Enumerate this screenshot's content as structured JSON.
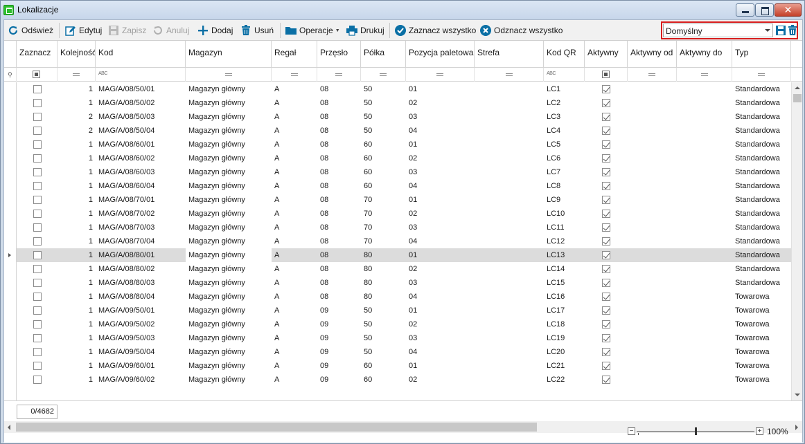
{
  "window": {
    "title": "Lokalizacje"
  },
  "toolbar": {
    "refresh": "Odśwież",
    "edit": "Edytuj",
    "save": "Zapisz",
    "cancel": "Anuluj",
    "add": "Dodaj",
    "delete": "Usuń",
    "operations": "Operacje",
    "print": "Drukuj",
    "select_all": "Zaznacz wszystko",
    "deselect_all": "Odznacz wszystko",
    "layout_value": "Domyślny"
  },
  "columns": [
    "Zaznacz",
    "Kolejność",
    "Kod",
    "Magazyn",
    "Regał",
    "Przęsło",
    "Półka",
    "Pozycja paletowa",
    "Strefa",
    "Kod QR",
    "Aktywny",
    "Aktywny od",
    "Aktywny do",
    "Typ"
  ],
  "rows": [
    {
      "kolejnosc": "1",
      "kod": "MAG/A/08/50/01",
      "magazyn": "Magazyn główny",
      "regal": "A",
      "przeslo": "08",
      "polka": "50",
      "pozycja": "01",
      "strefa": "",
      "kodqr": "LC1",
      "typ": "Standardowa"
    },
    {
      "kolejnosc": "1",
      "kod": "MAG/A/08/50/02",
      "magazyn": "Magazyn główny",
      "regal": "A",
      "przeslo": "08",
      "polka": "50",
      "pozycja": "02",
      "strefa": "",
      "kodqr": "LC2",
      "typ": "Standardowa"
    },
    {
      "kolejnosc": "2",
      "kod": "MAG/A/08/50/03",
      "magazyn": "Magazyn główny",
      "regal": "A",
      "przeslo": "08",
      "polka": "50",
      "pozycja": "03",
      "strefa": "",
      "kodqr": "LC3",
      "typ": "Standardowa"
    },
    {
      "kolejnosc": "2",
      "kod": "MAG/A/08/50/04",
      "magazyn": "Magazyn główny",
      "regal": "A",
      "przeslo": "08",
      "polka": "50",
      "pozycja": "04",
      "strefa": "",
      "kodqr": "LC4",
      "typ": "Standardowa"
    },
    {
      "kolejnosc": "1",
      "kod": "MAG/A/08/60/01",
      "magazyn": "Magazyn główny",
      "regal": "A",
      "przeslo": "08",
      "polka": "60",
      "pozycja": "01",
      "strefa": "",
      "kodqr": "LC5",
      "typ": "Standardowa"
    },
    {
      "kolejnosc": "1",
      "kod": "MAG/A/08/60/02",
      "magazyn": "Magazyn główny",
      "regal": "A",
      "przeslo": "08",
      "polka": "60",
      "pozycja": "02",
      "strefa": "",
      "kodqr": "LC6",
      "typ": "Standardowa"
    },
    {
      "kolejnosc": "1",
      "kod": "MAG/A/08/60/03",
      "magazyn": "Magazyn główny",
      "regal": "A",
      "przeslo": "08",
      "polka": "60",
      "pozycja": "03",
      "strefa": "",
      "kodqr": "LC7",
      "typ": "Standardowa"
    },
    {
      "kolejnosc": "1",
      "kod": "MAG/A/08/60/04",
      "magazyn": "Magazyn główny",
      "regal": "A",
      "przeslo": "08",
      "polka": "60",
      "pozycja": "04",
      "strefa": "",
      "kodqr": "LC8",
      "typ": "Standardowa"
    },
    {
      "kolejnosc": "1",
      "kod": "MAG/A/08/70/01",
      "magazyn": "Magazyn główny",
      "regal": "A",
      "przeslo": "08",
      "polka": "70",
      "pozycja": "01",
      "strefa": "",
      "kodqr": "LC9",
      "typ": "Standardowa"
    },
    {
      "kolejnosc": "1",
      "kod": "MAG/A/08/70/02",
      "magazyn": "Magazyn główny",
      "regal": "A",
      "przeslo": "08",
      "polka": "70",
      "pozycja": "02",
      "strefa": "",
      "kodqr": "LC10",
      "typ": "Standardowa"
    },
    {
      "kolejnosc": "1",
      "kod": "MAG/A/08/70/03",
      "magazyn": "Magazyn główny",
      "regal": "A",
      "przeslo": "08",
      "polka": "70",
      "pozycja": "03",
      "strefa": "",
      "kodqr": "LC11",
      "typ": "Standardowa"
    },
    {
      "kolejnosc": "1",
      "kod": "MAG/A/08/70/04",
      "magazyn": "Magazyn główny",
      "regal": "A",
      "przeslo": "08",
      "polka": "70",
      "pozycja": "04",
      "strefa": "",
      "kodqr": "LC12",
      "typ": "Standardowa"
    },
    {
      "kolejnosc": "1",
      "kod": "MAG/A/08/80/01",
      "magazyn": "Magazyn główny",
      "regal": "A",
      "przeslo": "08",
      "polka": "80",
      "pozycja": "01",
      "strefa": "",
      "kodqr": "LC13",
      "typ": "Standardowa",
      "selected": true
    },
    {
      "kolejnosc": "1",
      "kod": "MAG/A/08/80/02",
      "magazyn": "Magazyn główny",
      "regal": "A",
      "przeslo": "08",
      "polka": "80",
      "pozycja": "02",
      "strefa": "",
      "kodqr": "LC14",
      "typ": "Standardowa"
    },
    {
      "kolejnosc": "1",
      "kod": "MAG/A/08/80/03",
      "magazyn": "Magazyn główny",
      "regal": "A",
      "przeslo": "08",
      "polka": "80",
      "pozycja": "03",
      "strefa": "",
      "kodqr": "LC15",
      "typ": "Standardowa"
    },
    {
      "kolejnosc": "1",
      "kod": "MAG/A/08/80/04",
      "magazyn": "Magazyn główny",
      "regal": "A",
      "przeslo": "08",
      "polka": "80",
      "pozycja": "04",
      "strefa": "",
      "kodqr": "LC16",
      "typ": "Towarowa"
    },
    {
      "kolejnosc": "1",
      "kod": "MAG/A/09/50/01",
      "magazyn": "Magazyn główny",
      "regal": "A",
      "przeslo": "09",
      "polka": "50",
      "pozycja": "01",
      "strefa": "",
      "kodqr": "LC17",
      "typ": "Towarowa"
    },
    {
      "kolejnosc": "1",
      "kod": "MAG/A/09/50/02",
      "magazyn": "Magazyn główny",
      "regal": "A",
      "przeslo": "09",
      "polka": "50",
      "pozycja": "02",
      "strefa": "",
      "kodqr": "LC18",
      "typ": "Towarowa"
    },
    {
      "kolejnosc": "1",
      "kod": "MAG/A/09/50/03",
      "magazyn": "Magazyn główny",
      "regal": "A",
      "przeslo": "09",
      "polka": "50",
      "pozycja": "03",
      "strefa": "",
      "kodqr": "LC19",
      "typ": "Towarowa"
    },
    {
      "kolejnosc": "1",
      "kod": "MAG/A/09/50/04",
      "magazyn": "Magazyn główny",
      "regal": "A",
      "przeslo": "09",
      "polka": "50",
      "pozycja": "04",
      "strefa": "",
      "kodqr": "LC20",
      "typ": "Towarowa"
    },
    {
      "kolejnosc": "1",
      "kod": "MAG/A/09/60/01",
      "magazyn": "Magazyn główny",
      "regal": "A",
      "przeslo": "09",
      "polka": "60",
      "pozycja": "01",
      "strefa": "",
      "kodqr": "LC21",
      "typ": "Towarowa"
    },
    {
      "kolejnosc": "1",
      "kod": "MAG/A/09/60/02",
      "magazyn": "Magazyn główny",
      "regal": "A",
      "przeslo": "09",
      "polka": "60",
      "pozycja": "02",
      "strefa": "",
      "kodqr": "LC22",
      "typ": "Towarowa"
    }
  ],
  "footer": {
    "counter": "0/4682"
  },
  "zoom": {
    "value": "100%",
    "minus": "−",
    "plus": "+"
  },
  "colors": {
    "accent": "#0a6fa5",
    "highlight_border": "#d81e1e",
    "selected_row": "#dcdcdc"
  },
  "icons": {
    "refresh": "refresh-icon",
    "edit": "edit-icon",
    "save": "save-icon",
    "cancel": "undo-icon",
    "add": "plus-icon",
    "delete": "trash-icon",
    "operations": "folder-icon",
    "print": "printer-icon",
    "select_all": "check-circle-icon",
    "deselect_all": "x-circle-icon"
  }
}
